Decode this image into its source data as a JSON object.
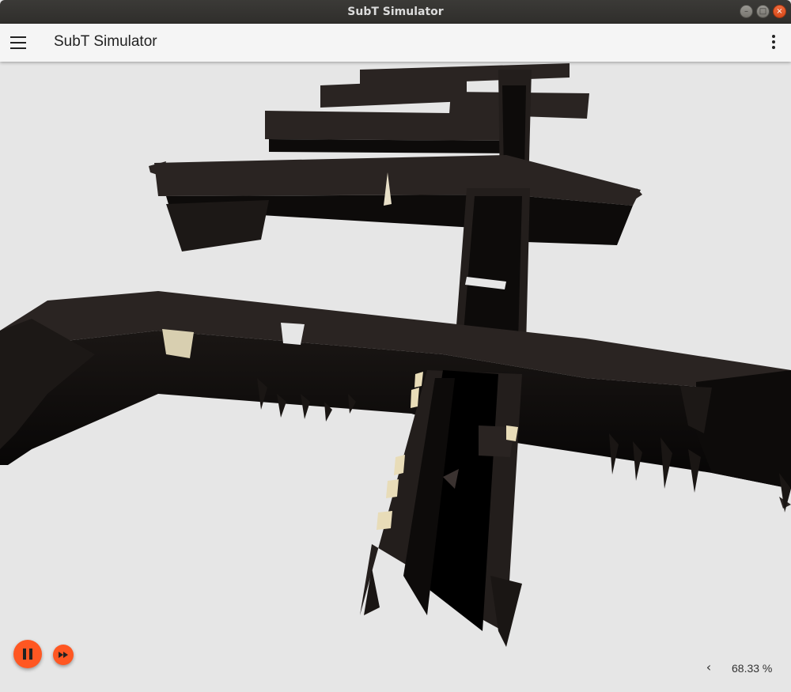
{
  "window": {
    "title": "SubT Simulator"
  },
  "appbar": {
    "title": "SubT Simulator"
  },
  "status": {
    "real_time_factor": "68.33 %"
  },
  "colors": {
    "accent": "#ff5722",
    "tunnel": "#2a2422",
    "tunnel_dark": "#0d0b0a",
    "rock_highlight": "#e8dcb8",
    "background": "#e6e6e6"
  },
  "icons": {
    "menu": "hamburger-icon",
    "more": "more-vert-icon",
    "pause": "pause-icon",
    "fast_forward": "fast-forward-icon",
    "collapse": "chevron-left-icon"
  }
}
